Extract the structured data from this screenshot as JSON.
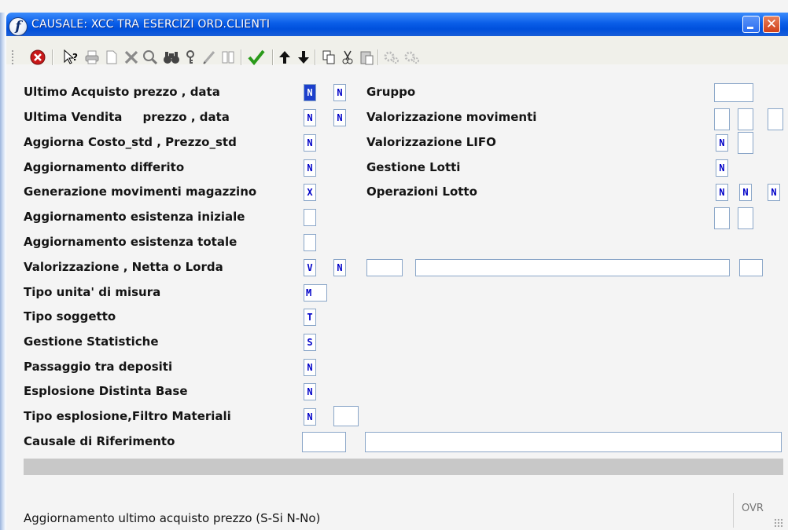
{
  "window": {
    "title": "CAUSALE: XCC TRA ESERCIZI ORD.CLIENTI"
  },
  "toolbar": {
    "icons": [
      "stop-icon",
      "help-icon",
      "print-icon",
      "new-icon",
      "delete-icon",
      "search-icon",
      "find-icon",
      "key-icon",
      "edit-icon",
      "columns-icon",
      "confirm-icon",
      "up-arrow-icon",
      "down-arrow-icon",
      "copy-icon",
      "cut-icon",
      "paste-icon",
      "gears-icon",
      "gears2-icon"
    ]
  },
  "form": {
    "left_labels": {
      "ultimo_acquisto": "Ultimo Acquisto prezzo , data",
      "ultima_vendita": "Ultima Vendita     prezzo , data",
      "aggiorna_costo": "Aggiorna Costo_std , Prezzo_std",
      "aggiornamento_differito": "Aggiornamento differito",
      "generazione_movimenti": "Generazione movimenti magazzino",
      "esistenza_iniziale": "Aggiornamento esistenza iniziale",
      "esistenza_totale": "Aggiornamento esistenza totale",
      "valorizzazione": "Valorizzazione , Netta o Lorda",
      "tipo_unita": "Tipo unita' di misura",
      "tipo_soggetto": "Tipo soggetto",
      "gestione_statistiche": "Gestione Statistiche",
      "passaggio_depositi": "Passaggio tra depositi",
      "esplosione_distinta": "Esplosione Distinta Base",
      "tipo_esplosione": "Tipo esplosione,Filtro Materiali",
      "causale_riferimento": "Causale di Riferimento"
    },
    "right_labels": {
      "gruppo": "Gruppo",
      "valorizzazione_movimenti": "Valorizzazione movimenti",
      "valorizzazione_lifo": "Valorizzazione LIFO",
      "gestione_lotti": "Gestione Lotti",
      "operazioni_lotto": "Operazioni Lotto"
    },
    "values": {
      "ultimo_acquisto_prezzo": "N",
      "ultimo_acquisto_data": "N",
      "ultima_vendita_prezzo": "N",
      "ultima_vendita_data": "N",
      "aggiorna_costo": "N",
      "aggiornamento_differito": "N",
      "generazione_movimenti": "X",
      "esistenza_iniziale": "",
      "esistenza_totale": "",
      "valorizzazione_1": "V",
      "valorizzazione_2": "N",
      "valorizzazione_3": "",
      "valorizzazione_4": "",
      "valorizzazione_5": "",
      "tipo_unita": "M",
      "tipo_soggetto": "T",
      "gestione_statistiche": "S",
      "passaggio_depositi": "N",
      "esplosione_distinta": "N",
      "tipo_esplosione": "N",
      "filtro_materiali": "",
      "causale_riferimento_code": "",
      "causale_riferimento_desc": "",
      "gruppo": "",
      "val_mov_1": "",
      "val_mov_2": "",
      "val_mov_3": "",
      "lifo_1": "N",
      "lifo_2": "",
      "gestione_lotti": "N",
      "operazioni_lotto_1": "N",
      "operazioni_lotto_2": "N",
      "operazioni_lotto_3": "N",
      "right_extra_1": "",
      "right_extra_2": ""
    }
  },
  "status": {
    "message": "Aggiornamento ultimo acquisto prezzo (S-Si N-No)",
    "mode": "OVR"
  }
}
